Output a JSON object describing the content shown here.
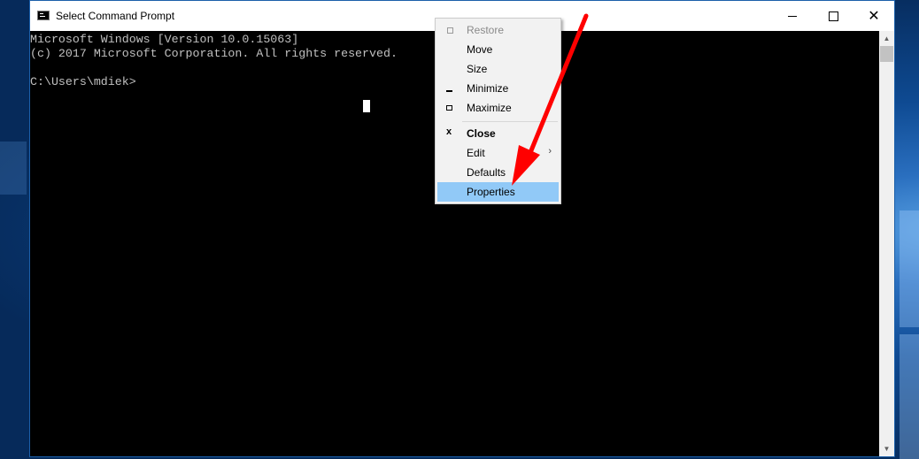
{
  "window": {
    "title": "Select Command Prompt",
    "minimize_icon": "minimize-icon",
    "maximize_icon": "maximize-icon",
    "close_icon": "close-icon"
  },
  "console": {
    "lines": [
      "Microsoft Windows [Version 10.0.15063]",
      "(c) 2017 Microsoft Corporation. All rights reserved.",
      "",
      "C:\\Users\\mdiek>"
    ]
  },
  "system_menu": {
    "items": [
      {
        "label": "Restore",
        "icon": "restore-icon",
        "state": "disabled"
      },
      {
        "label": "Move",
        "icon": "",
        "state": "normal"
      },
      {
        "label": "Size",
        "icon": "",
        "state": "normal"
      },
      {
        "label": "Minimize",
        "icon": "minimize-icon",
        "state": "normal"
      },
      {
        "label": "Maximize",
        "icon": "maximize-icon",
        "state": "normal"
      },
      {
        "label": "Close",
        "icon": "close-icon",
        "state": "bold"
      },
      {
        "label": "Edit",
        "icon": "",
        "state": "normal",
        "submenu": true
      },
      {
        "label": "Defaults",
        "icon": "",
        "state": "normal"
      },
      {
        "label": "Properties",
        "icon": "",
        "state": "highlighted"
      }
    ],
    "close_glyph": "x",
    "submenu_glyph": "›"
  },
  "colors": {
    "menu_highlight": "#91c9f7",
    "annotation_arrow": "#ff0000",
    "console_text": "#c0c0c0"
  }
}
